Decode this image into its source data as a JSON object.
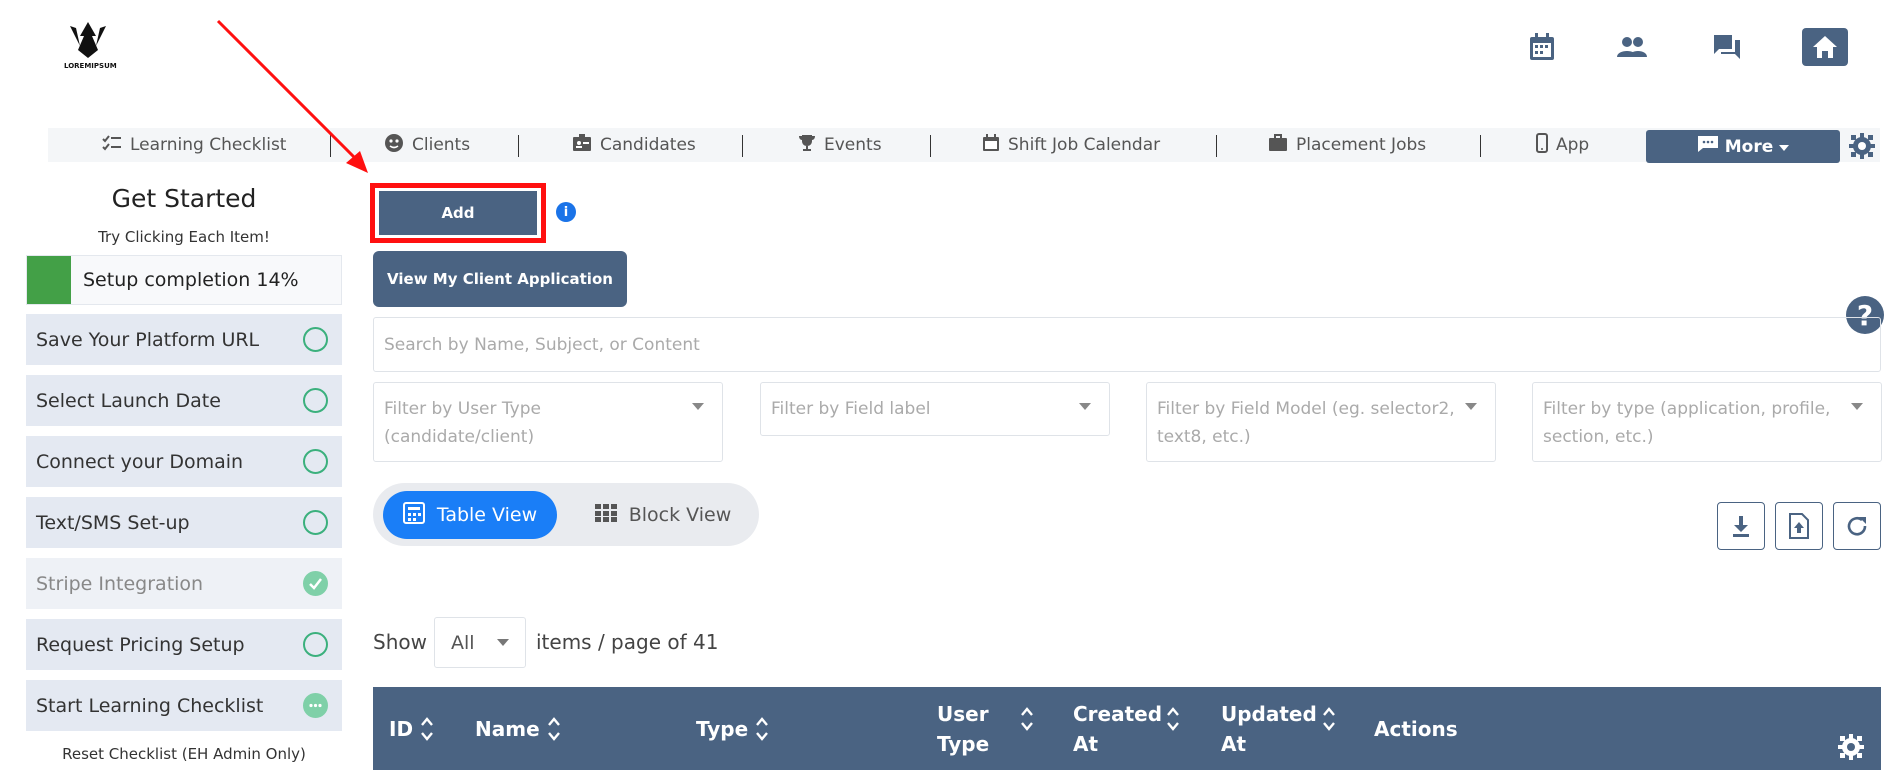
{
  "brand": {
    "logo_text": "LOREMIPSUM"
  },
  "header_icons": [
    "calendar-icon",
    "people-icon",
    "chat-icon",
    "home-icon"
  ],
  "nav": {
    "items": [
      {
        "label": "Learning Checklist",
        "icon": "checklist-icon"
      },
      {
        "label": "Clients",
        "icon": "face-icon"
      },
      {
        "label": "Candidates",
        "icon": "id-badge-icon"
      },
      {
        "label": "Events",
        "icon": "trophy-icon"
      },
      {
        "label": "Shift Job Calendar",
        "icon": "calendar-icon"
      },
      {
        "label": "Placement Jobs",
        "icon": "briefcase-icon"
      },
      {
        "label": "App",
        "icon": "phone-icon"
      }
    ],
    "more_label": "More"
  },
  "sidebar": {
    "title": "Get Started",
    "subtitle": "Try Clicking Each Item!",
    "progress_label": "Setup completion 14%",
    "progress_fraction": 0.14,
    "items": [
      {
        "label": "Save Your Platform URL",
        "status": "pending"
      },
      {
        "label": "Select Launch Date",
        "status": "pending"
      },
      {
        "label": "Connect your Domain",
        "status": "pending"
      },
      {
        "label": "Text/SMS Set-up",
        "status": "pending"
      },
      {
        "label": "Stripe Integration",
        "status": "done"
      },
      {
        "label": "Request Pricing Setup",
        "status": "pending"
      },
      {
        "label": "Start Learning Checklist",
        "status": "in-progress"
      }
    ],
    "reset_label": "Reset Checklist (EH Admin Only)"
  },
  "main": {
    "add_label": "Add",
    "view_app_label": "View My Client Application",
    "search_placeholder": "Search by Name, Subject, or Content",
    "filters": [
      "Filter by User Type (candidate/client)",
      "Filter by Field label",
      "Filter by Field Model (eg. selector2, text8, etc.)",
      "Filter by type (application, profile, section, etc.)"
    ],
    "table_view_label": "Table View",
    "block_view_label": "Block View",
    "show_label": "Show",
    "page_size": "All",
    "page_info": "items / page of 41",
    "columns": [
      "ID",
      "Name",
      "Type",
      "User Type",
      "Created At",
      "Updated At",
      "Actions"
    ]
  },
  "colors": {
    "primary": "#4a6382",
    "accent_blue": "#1a7ef7",
    "highlight_red": "#ff1010",
    "success_green": "#43a047"
  }
}
